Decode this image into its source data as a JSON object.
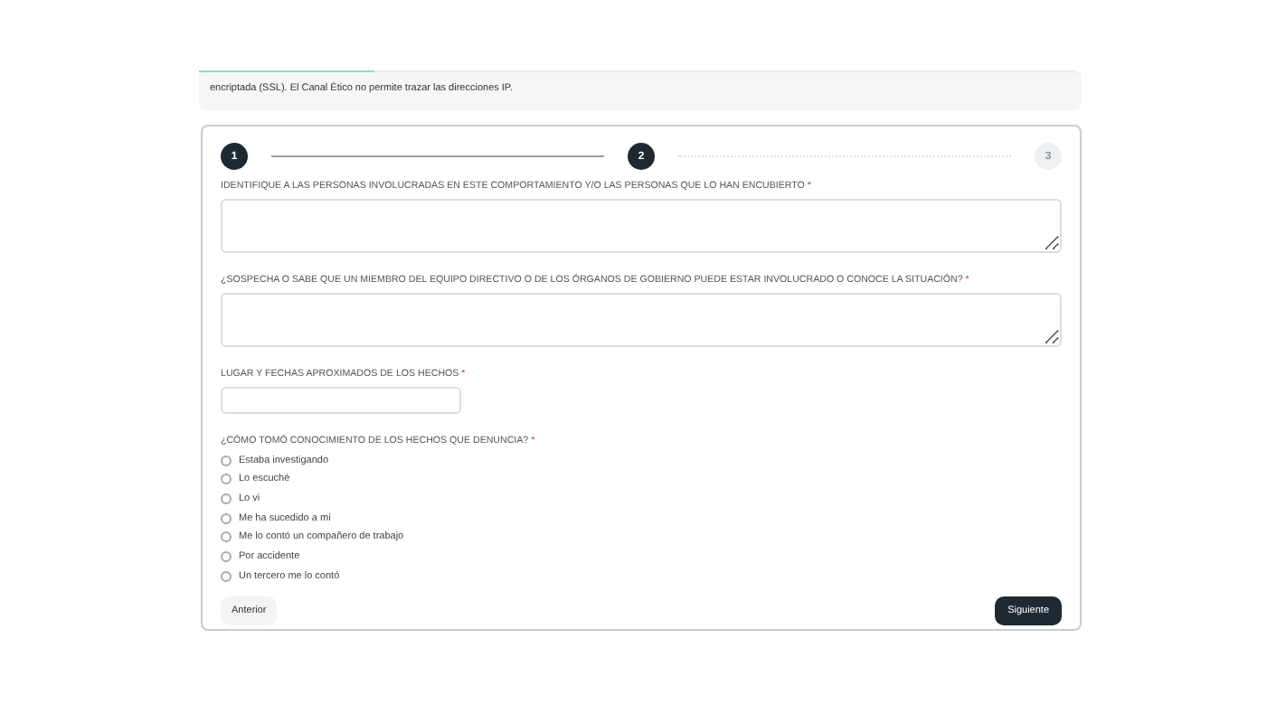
{
  "notice": {
    "text": "encriptada (SSL). El Canal Ético no permite trazar las direcciones IP."
  },
  "steps": [
    {
      "label": "1",
      "active": true
    },
    {
      "label": "2",
      "active": true
    },
    {
      "label": "3",
      "active": false
    }
  ],
  "fields": [
    {
      "kind": "textarea",
      "label": "IDENTIFIQUE A LAS PERSONAS INVOLUCRADAS EN ESTE COMPORTAMIENTO Y/O LAS PERSONAS QUE LO HAN ENCUBIERTO",
      "required": "*"
    },
    {
      "kind": "textarea",
      "label": "¿SOSPECHA O SABE QUE UN MIEMBRO DEL EQUIPO DIRECTIVO O DE LOS ÓRGANOS DE GOBIERNO PUEDE ESTAR INVOLUCRADO O CONOCE LA SITUACIÓN?",
      "required": "*"
    },
    {
      "kind": "input",
      "label": "LUGAR Y FECHAS APROXIMADOS DE LOS HECHOS",
      "required": "*"
    },
    {
      "kind": "radio",
      "label": "¿CÓMO TOMÓ CONOCIMIENTO DE LOS HECHOS QUE DENUNCIA?",
      "required": "*",
      "options": [
        {
          "label": "Estaba investigando",
          "selected": false
        },
        {
          "label": "Lo escuché",
          "selected": false
        },
        {
          "label": "Lo vi",
          "selected": false
        },
        {
          "label": "Me ha sucedido a mí",
          "selected": false
        },
        {
          "label": "Me lo contó un compañero de trabajo",
          "selected": false
        },
        {
          "label": "Por accidente",
          "selected": false
        },
        {
          "label": "Un tercero me lo contó",
          "selected": false
        }
      ]
    }
  ],
  "buttons": {
    "back": "Anterior",
    "next": "Siguiente"
  }
}
